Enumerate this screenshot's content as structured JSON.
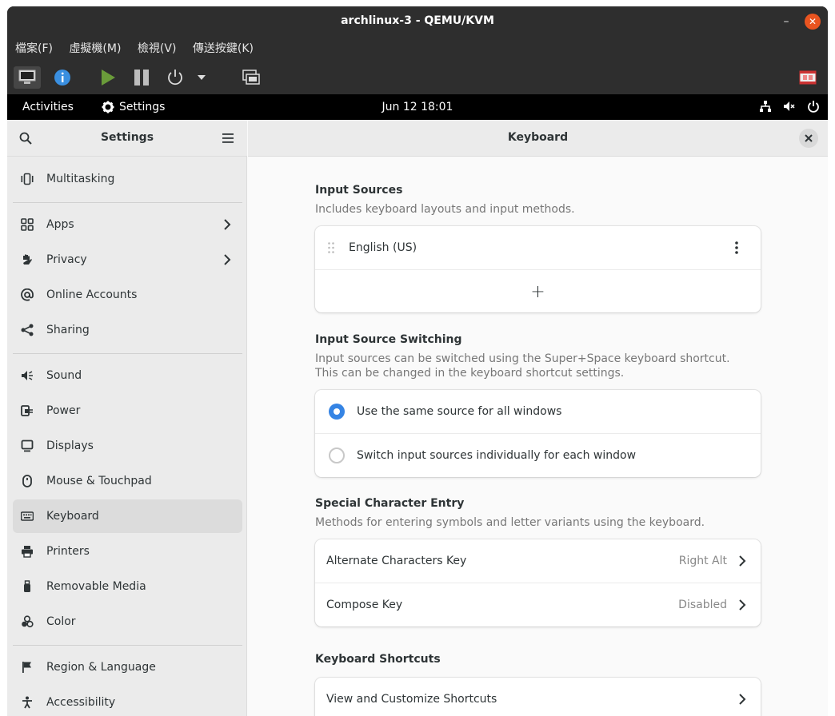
{
  "window": {
    "title": "archlinux-3 - QEMU/KVM"
  },
  "menubar": {
    "items": [
      "檔案(F)",
      "虛擬機(M)",
      "檢視(V)",
      "傳送按鍵(K)"
    ]
  },
  "topbar": {
    "activities": "Activities",
    "app_menu": "Settings",
    "clock": "Jun 12  18:01"
  },
  "sidebar": {
    "title": "Settings",
    "items": [
      {
        "label": "Multitasking",
        "icon": "multitasking-icon"
      },
      {
        "label": "Apps",
        "icon": "apps-icon",
        "chevron": true
      },
      {
        "label": "Privacy",
        "icon": "hand-icon",
        "chevron": true
      },
      {
        "label": "Online Accounts",
        "icon": "at-icon"
      },
      {
        "label": "Sharing",
        "icon": "share-icon"
      },
      {
        "label": "Sound",
        "icon": "speaker-icon"
      },
      {
        "label": "Power",
        "icon": "power-plug-icon"
      },
      {
        "label": "Displays",
        "icon": "display-icon"
      },
      {
        "label": "Mouse & Touchpad",
        "icon": "mouse-icon"
      },
      {
        "label": "Keyboard",
        "icon": "keyboard-icon",
        "selected": true
      },
      {
        "label": "Printers",
        "icon": "printer-icon"
      },
      {
        "label": "Removable Media",
        "icon": "usb-icon"
      },
      {
        "label": "Color",
        "icon": "color-icon"
      },
      {
        "label": "Region & Language",
        "icon": "flag-icon"
      },
      {
        "label": "Accessibility",
        "icon": "accessibility-icon"
      }
    ]
  },
  "content": {
    "title": "Keyboard",
    "input_sources": {
      "title": "Input Sources",
      "desc": "Includes keyboard layouts and input methods.",
      "sources": [
        "English (US)"
      ],
      "add_label": "+"
    },
    "switching": {
      "title": "Input Source Switching",
      "desc1": "Input sources can be switched using the Super+Space keyboard shortcut.",
      "desc2": "This can be changed in the keyboard shortcut settings.",
      "options": [
        {
          "label": "Use the same source for all windows",
          "selected": true
        },
        {
          "label": "Switch input sources individually for each window",
          "selected": false
        }
      ]
    },
    "special": {
      "title": "Special Character Entry",
      "desc": "Methods for entering symbols and letter variants using the keyboard.",
      "rows": [
        {
          "label": "Alternate Characters Key",
          "value": "Right Alt"
        },
        {
          "label": "Compose Key",
          "value": "Disabled"
        }
      ]
    },
    "shortcuts": {
      "title": "Keyboard Shortcuts",
      "row": "View and Customize Shortcuts"
    }
  },
  "colors": {
    "accent": "#3584e4",
    "close": "#e95420"
  }
}
